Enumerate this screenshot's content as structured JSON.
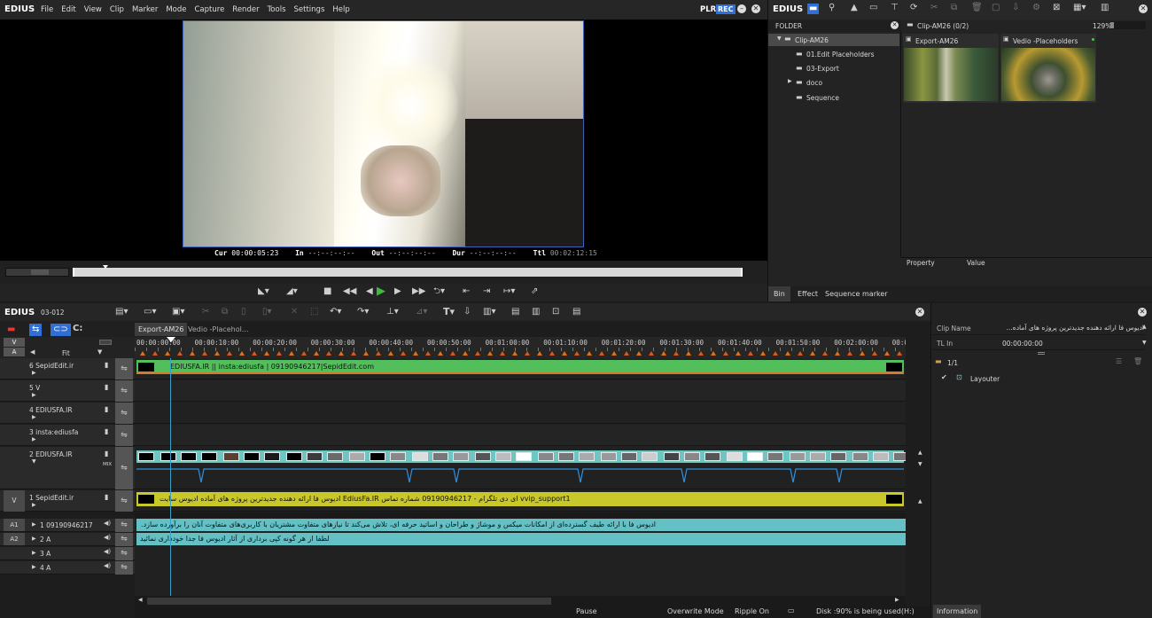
{
  "app": {
    "name": "EDIUS",
    "menus": [
      "File",
      "Edit",
      "View",
      "Clip",
      "Marker",
      "Mode",
      "Capture",
      "Render",
      "Tools",
      "Settings",
      "Help"
    ],
    "plr": "PLR",
    "rec": "REC"
  },
  "player": {
    "cur_label": "Cur",
    "cur": "00:00:05:23",
    "in_label": "In",
    "in": "--:--:--:--",
    "out_label": "Out",
    "out": "--:--:--:--",
    "dur_label": "Dur",
    "dur": "--:--:--:--",
    "ttl_label": "Ttl",
    "ttl": "00:02:12:15"
  },
  "bin": {
    "app_name": "EDIUS",
    "folder_label": "FOLDER",
    "tree": [
      {
        "label": "Clip-AM26",
        "level": 0,
        "expanded": true,
        "selected": true
      },
      {
        "label": "01.Edit Placeholders",
        "level": 1
      },
      {
        "label": "03-Export",
        "level": 1
      },
      {
        "label": "doco",
        "level": 1,
        "collapsed": true
      },
      {
        "label": "Sequence",
        "level": 1
      }
    ],
    "path": "Clip-AM26 (0/2)",
    "zoom": "129%",
    "clips": [
      {
        "label": "Export-AM26"
      },
      {
        "label": "Vedio -Placeholders"
      }
    ],
    "property_headers": {
      "property": "Property",
      "value": "Value"
    },
    "tabs": [
      "Bin",
      "Effect",
      "Sequence marker"
    ]
  },
  "timeline": {
    "app_name": "EDIUS",
    "sequence_id": "03-012",
    "fit_label": "Fit",
    "tabs": [
      "Export-AM26",
      "Vedio -Placehol..."
    ],
    "ruler": [
      "00:00:00:00",
      "00:00:10:00",
      "00:00:20:00",
      "00:00:30:00",
      "00:00:40:00",
      "00:00:50:00",
      "00:01:00:00",
      "00:01:10:00",
      "00:01:20:00",
      "00:01:30:00",
      "00:01:40:00",
      "00:01:50:00",
      "00:02:00:00",
      "00:02:1"
    ],
    "video_patch": "V",
    "audio_patch": "A",
    "tracks": [
      {
        "name": "6 SepidEdit.ir",
        "clip": "EDIUSFA.IR || insta:ediusfa |  09190946217|SepidEdit.com"
      },
      {
        "name": "5 V"
      },
      {
        "name": "4 EDIUSFA.IR"
      },
      {
        "name": "3 insta:ediusfa"
      },
      {
        "name": "2 EDIUSFA.IR",
        "mix": "MIX"
      },
      {
        "name": "1 SepidEdit.ir",
        "patch": "V",
        "clip": "ادیوس فا ارائه دهنده جدیدترین پروژه های آماده ادیوس سایت EdiusFa.IR   ای دی تلگرام - 09190946217   شماره تماس  vvip_support1"
      }
    ],
    "audio_tracks": [
      {
        "patch": "A1",
        "name": "1 09190946217",
        "clip": "ادیوس فا  با ارائه طیف گسترده‌ای از امکانات میکس و موشاژ و طراحان و اساتید حرفه ای، تلاش می‌کند تا نیازهای متفاوت مشتریان با کاربری‌های متفاوت آنان را برآورده سازد."
      },
      {
        "patch": "A2",
        "name": "2 A",
        "clip": "لطفا از هر گونه کپی برداری از آثار ادیوس فا جدا خودداری نمائید"
      },
      {
        "name": "3 A"
      },
      {
        "name": "4 A"
      }
    ]
  },
  "info": {
    "clip_name_label": "Clip Name",
    "clip_name": "ادیوس فا ارائه دهنده جدیدترین پروژه های آماده...",
    "tl_in_label": "TL In",
    "tl_in": "00:00:00:00",
    "page": "1/1",
    "layer": "Layouter",
    "tab": "Information"
  },
  "status": {
    "pause": "Pause",
    "mode": "Overwrite Mode",
    "ripple": "Ripple On",
    "disk": "Disk :90% is being used(H:)"
  }
}
